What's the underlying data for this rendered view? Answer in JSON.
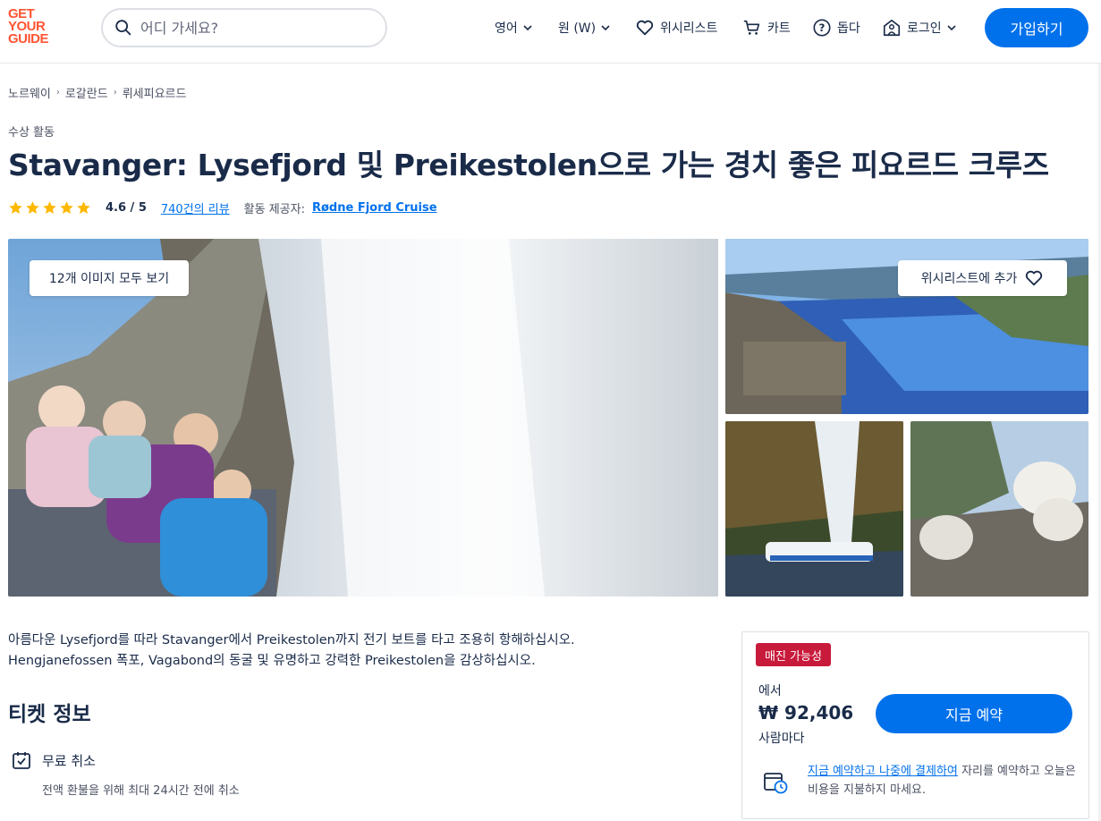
{
  "header": {
    "logo": [
      "GET",
      "YOUR",
      "GUIDE"
    ],
    "search_placeholder": "어디 가세요?",
    "language": "영어",
    "currency": "원 (W)",
    "wishlist": "위시리스트",
    "cart": "카트",
    "help": "돕다",
    "login": "로그인",
    "signup": "가입하기"
  },
  "breadcrumb": [
    "노르웨이",
    "로갈란드",
    "뤼세피요르드"
  ],
  "category": "수상 활동",
  "title": "Stavanger: Lysefjord 및 Preikestolen으로 가는 경치 좋은 피요르드 크루즈",
  "rating": {
    "stars": 5,
    "value": "4.6 / 5",
    "reviews": "740건의 리뷰",
    "provider_label": "활동 제공자:",
    "provider": "Rødne Fjord Cruise"
  },
  "gallery": {
    "view_all": "12개 이미지 모두 보기",
    "wishlist_add": "위시리스트에 추가"
  },
  "description": {
    "line1": "아름다운 Lysefjord를 따라 Stavanger에서 Preikestolen까지 전기 보트를 타고 조용히 항해하십시오.",
    "line2": "Hengjanefossen 폭포, Vagabond의 동굴 및 유명하고 강력한 Preikestolen을 감상하십시오."
  },
  "tickets": {
    "title": "티켓 정보",
    "feature_title": "무료 취소",
    "feature_desc": "전액 환불을 위해 최대 24시간 전에 취소"
  },
  "booking": {
    "badge": "매진 가능성",
    "from": "에서",
    "price": "₩ 92,406",
    "per": "사람마다",
    "book": "지금 예약",
    "reserve_link": "지금 예약하고 나중에 결제하여",
    "reserve_rest": " 자리를 예약하고 오늘은 비용을 지불하지 마세요."
  },
  "colors": {
    "brand": "#ff5533",
    "primary": "#0071eb",
    "badge": "#c81a3b",
    "star": "#ffb800"
  }
}
